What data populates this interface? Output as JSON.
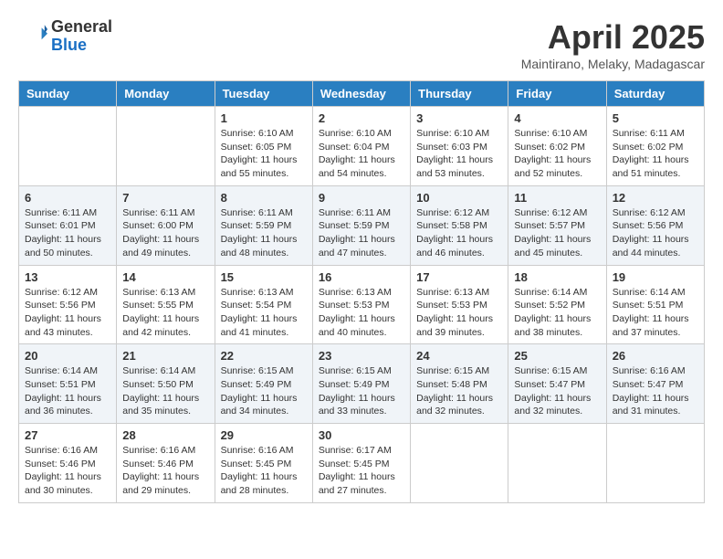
{
  "header": {
    "logo_general": "General",
    "logo_blue": "Blue",
    "month_title": "April 2025",
    "location": "Maintirano, Melaky, Madagascar"
  },
  "weekdays": [
    "Sunday",
    "Monday",
    "Tuesday",
    "Wednesday",
    "Thursday",
    "Friday",
    "Saturday"
  ],
  "weeks": [
    [
      {
        "day": "",
        "sunrise": "",
        "sunset": "",
        "daylight": ""
      },
      {
        "day": "",
        "sunrise": "",
        "sunset": "",
        "daylight": ""
      },
      {
        "day": "1",
        "sunrise": "Sunrise: 6:10 AM",
        "sunset": "Sunset: 6:05 PM",
        "daylight": "Daylight: 11 hours and 55 minutes."
      },
      {
        "day": "2",
        "sunrise": "Sunrise: 6:10 AM",
        "sunset": "Sunset: 6:04 PM",
        "daylight": "Daylight: 11 hours and 54 minutes."
      },
      {
        "day": "3",
        "sunrise": "Sunrise: 6:10 AM",
        "sunset": "Sunset: 6:03 PM",
        "daylight": "Daylight: 11 hours and 53 minutes."
      },
      {
        "day": "4",
        "sunrise": "Sunrise: 6:10 AM",
        "sunset": "Sunset: 6:02 PM",
        "daylight": "Daylight: 11 hours and 52 minutes."
      },
      {
        "day": "5",
        "sunrise": "Sunrise: 6:11 AM",
        "sunset": "Sunset: 6:02 PM",
        "daylight": "Daylight: 11 hours and 51 minutes."
      }
    ],
    [
      {
        "day": "6",
        "sunrise": "Sunrise: 6:11 AM",
        "sunset": "Sunset: 6:01 PM",
        "daylight": "Daylight: 11 hours and 50 minutes."
      },
      {
        "day": "7",
        "sunrise": "Sunrise: 6:11 AM",
        "sunset": "Sunset: 6:00 PM",
        "daylight": "Daylight: 11 hours and 49 minutes."
      },
      {
        "day": "8",
        "sunrise": "Sunrise: 6:11 AM",
        "sunset": "Sunset: 5:59 PM",
        "daylight": "Daylight: 11 hours and 48 minutes."
      },
      {
        "day": "9",
        "sunrise": "Sunrise: 6:11 AM",
        "sunset": "Sunset: 5:59 PM",
        "daylight": "Daylight: 11 hours and 47 minutes."
      },
      {
        "day": "10",
        "sunrise": "Sunrise: 6:12 AM",
        "sunset": "Sunset: 5:58 PM",
        "daylight": "Daylight: 11 hours and 46 minutes."
      },
      {
        "day": "11",
        "sunrise": "Sunrise: 6:12 AM",
        "sunset": "Sunset: 5:57 PM",
        "daylight": "Daylight: 11 hours and 45 minutes."
      },
      {
        "day": "12",
        "sunrise": "Sunrise: 6:12 AM",
        "sunset": "Sunset: 5:56 PM",
        "daylight": "Daylight: 11 hours and 44 minutes."
      }
    ],
    [
      {
        "day": "13",
        "sunrise": "Sunrise: 6:12 AM",
        "sunset": "Sunset: 5:56 PM",
        "daylight": "Daylight: 11 hours and 43 minutes."
      },
      {
        "day": "14",
        "sunrise": "Sunrise: 6:13 AM",
        "sunset": "Sunset: 5:55 PM",
        "daylight": "Daylight: 11 hours and 42 minutes."
      },
      {
        "day": "15",
        "sunrise": "Sunrise: 6:13 AM",
        "sunset": "Sunset: 5:54 PM",
        "daylight": "Daylight: 11 hours and 41 minutes."
      },
      {
        "day": "16",
        "sunrise": "Sunrise: 6:13 AM",
        "sunset": "Sunset: 5:53 PM",
        "daylight": "Daylight: 11 hours and 40 minutes."
      },
      {
        "day": "17",
        "sunrise": "Sunrise: 6:13 AM",
        "sunset": "Sunset: 5:53 PM",
        "daylight": "Daylight: 11 hours and 39 minutes."
      },
      {
        "day": "18",
        "sunrise": "Sunrise: 6:14 AM",
        "sunset": "Sunset: 5:52 PM",
        "daylight": "Daylight: 11 hours and 38 minutes."
      },
      {
        "day": "19",
        "sunrise": "Sunrise: 6:14 AM",
        "sunset": "Sunset: 5:51 PM",
        "daylight": "Daylight: 11 hours and 37 minutes."
      }
    ],
    [
      {
        "day": "20",
        "sunrise": "Sunrise: 6:14 AM",
        "sunset": "Sunset: 5:51 PM",
        "daylight": "Daylight: 11 hours and 36 minutes."
      },
      {
        "day": "21",
        "sunrise": "Sunrise: 6:14 AM",
        "sunset": "Sunset: 5:50 PM",
        "daylight": "Daylight: 11 hours and 35 minutes."
      },
      {
        "day": "22",
        "sunrise": "Sunrise: 6:15 AM",
        "sunset": "Sunset: 5:49 PM",
        "daylight": "Daylight: 11 hours and 34 minutes."
      },
      {
        "day": "23",
        "sunrise": "Sunrise: 6:15 AM",
        "sunset": "Sunset: 5:49 PM",
        "daylight": "Daylight: 11 hours and 33 minutes."
      },
      {
        "day": "24",
        "sunrise": "Sunrise: 6:15 AM",
        "sunset": "Sunset: 5:48 PM",
        "daylight": "Daylight: 11 hours and 32 minutes."
      },
      {
        "day": "25",
        "sunrise": "Sunrise: 6:15 AM",
        "sunset": "Sunset: 5:47 PM",
        "daylight": "Daylight: 11 hours and 32 minutes."
      },
      {
        "day": "26",
        "sunrise": "Sunrise: 6:16 AM",
        "sunset": "Sunset: 5:47 PM",
        "daylight": "Daylight: 11 hours and 31 minutes."
      }
    ],
    [
      {
        "day": "27",
        "sunrise": "Sunrise: 6:16 AM",
        "sunset": "Sunset: 5:46 PM",
        "daylight": "Daylight: 11 hours and 30 minutes."
      },
      {
        "day": "28",
        "sunrise": "Sunrise: 6:16 AM",
        "sunset": "Sunset: 5:46 PM",
        "daylight": "Daylight: 11 hours and 29 minutes."
      },
      {
        "day": "29",
        "sunrise": "Sunrise: 6:16 AM",
        "sunset": "Sunset: 5:45 PM",
        "daylight": "Daylight: 11 hours and 28 minutes."
      },
      {
        "day": "30",
        "sunrise": "Sunrise: 6:17 AM",
        "sunset": "Sunset: 5:45 PM",
        "daylight": "Daylight: 11 hours and 27 minutes."
      },
      {
        "day": "",
        "sunrise": "",
        "sunset": "",
        "daylight": ""
      },
      {
        "day": "",
        "sunrise": "",
        "sunset": "",
        "daylight": ""
      },
      {
        "day": "",
        "sunrise": "",
        "sunset": "",
        "daylight": ""
      }
    ]
  ]
}
